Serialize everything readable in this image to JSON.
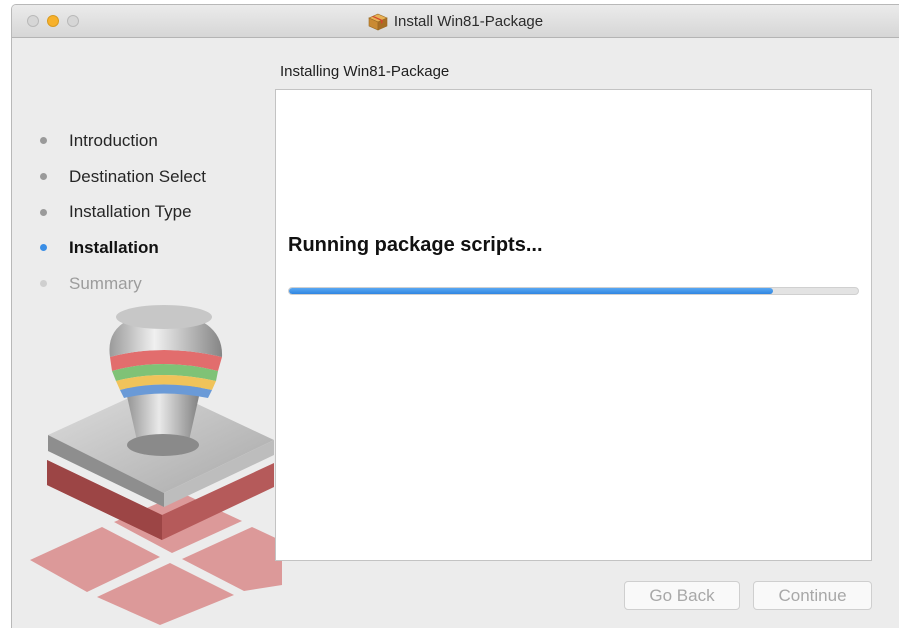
{
  "window": {
    "title": "Install Win81-Package",
    "icon": "package-icon"
  },
  "header": {
    "section_title": "Installing Win81-Package"
  },
  "sidebar": {
    "steps": [
      {
        "label": "Introduction",
        "state": "done"
      },
      {
        "label": "Destination Select",
        "state": "done"
      },
      {
        "label": "Installation Type",
        "state": "done"
      },
      {
        "label": "Installation",
        "state": "current"
      },
      {
        "label": "Summary",
        "state": "pending"
      }
    ]
  },
  "main": {
    "status_text": "Running package scripts...",
    "progress_percent": 85
  },
  "buttons": {
    "back_label": "Go Back",
    "continue_label": "Continue"
  },
  "colors": {
    "accent": "#3a8ee6",
    "minimize": "#f7b12b"
  }
}
